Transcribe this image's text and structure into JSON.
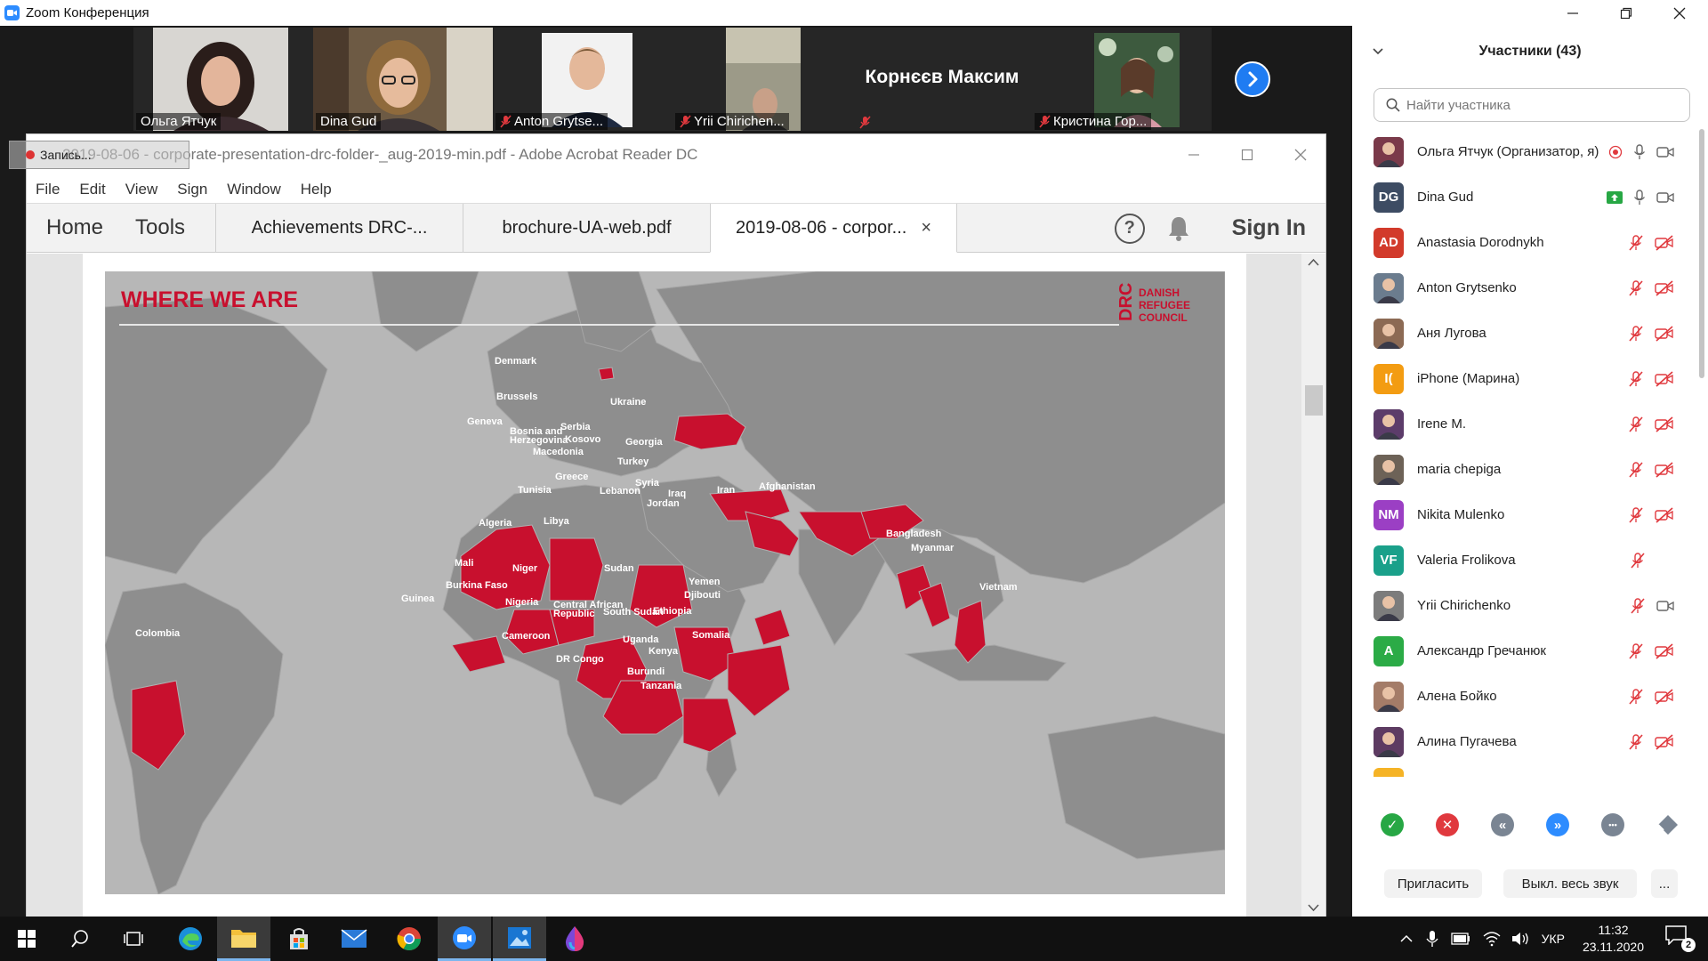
{
  "zoom": {
    "window_title": "Zoom Конференция"
  },
  "video_strip": {
    "tiles": [
      {
        "name": "Ольга Ятчук",
        "muted": false,
        "active": false
      },
      {
        "name": "Dina Gud",
        "muted": false,
        "active": true
      },
      {
        "name": "Anton Grytse...",
        "muted": true,
        "active": false
      },
      {
        "name": "Yrii Chirichen...",
        "muted": true,
        "active": false
      },
      {
        "name": "Корнєєв Максим",
        "muted": true,
        "active": false
      },
      {
        "name": "Кристина Гор...",
        "muted": true,
        "active": false
      }
    ]
  },
  "share_badge": {
    "label": "Запись..."
  },
  "acrobat": {
    "window_title": "2019-08-06 - corporate-presentation-drc-folder-_aug-2019-min.pdf - Adobe Acrobat Reader DC",
    "menu": [
      "File",
      "Edit",
      "View",
      "Sign",
      "Window",
      "Help"
    ],
    "nav": {
      "home": "Home",
      "tools": "Tools"
    },
    "tabs": [
      {
        "label": "Achievements DRC-...",
        "active": false
      },
      {
        "label": "brochure-UA-web.pdf",
        "active": false
      },
      {
        "label": "2019-08-06 - corpor...",
        "active": true
      }
    ],
    "tab_close": "×",
    "sign_in": "Sign In",
    "help_glyph": "?"
  },
  "slide": {
    "title": "WHERE WE ARE",
    "logo": {
      "mark": "DRC",
      "line1": "DANISH",
      "line2": "REFUGEE",
      "line3": "COUNCIL"
    },
    "country_labels": [
      "Denmark",
      "Brussels",
      "Ukraine",
      "Geneva",
      "Bosnia and Herzegovina",
      "Serbia",
      "Kosovo",
      "Georgia",
      "Macedonia",
      "Turkey",
      "Greece",
      "Syria",
      "Lebanon",
      "Iraq",
      "Iran",
      "Afghanistan",
      "Jordan",
      "Tunisia",
      "Algeria",
      "Libya",
      "Mali",
      "Niger",
      "Sudan",
      "Yemen",
      "Djibouti",
      "Burkina Faso",
      "Guinea",
      "Nigeria",
      "Central African Republic",
      "South Sudan",
      "Ethiopia",
      "Cameroon",
      "Somalia",
      "Uganda",
      "Kenya",
      "DR Congo",
      "Burundi",
      "Tanzania",
      "Colombia",
      "Bangladesh",
      "Myanmar",
      "Vietnam"
    ]
  },
  "participants": {
    "title": "Участники (43)",
    "search_placeholder": "Найти участника",
    "list": [
      {
        "name": "Ольга Ятчук (Организатор, я)",
        "avatar": "photo",
        "color": "#7a3a4a",
        "mic": "on",
        "video": "on",
        "extra": "record"
      },
      {
        "name": "Dina Gud",
        "initials": "DG",
        "color": "#3d4c63",
        "mic": "on",
        "video": "on",
        "extra": "share"
      },
      {
        "name": "Anastasia Dorodnykh",
        "initials": "AD",
        "color": "#d23a2b",
        "mic": "off",
        "video": "off"
      },
      {
        "name": "Anton Grytsenko",
        "avatar": "photo",
        "color": "#6b7c8e",
        "mic": "off",
        "video": "off"
      },
      {
        "name": "Аня Лугова",
        "avatar": "photo",
        "color": "#8c6a54",
        "mic": "off",
        "video": "off"
      },
      {
        "name": "iPhone (Марина)",
        "initials": "I(",
        "color": "#f39c12",
        "mic": "off",
        "video": "off"
      },
      {
        "name": "Irene M.",
        "avatar": "photo",
        "color": "#5c3c6a",
        "mic": "off",
        "video": "off"
      },
      {
        "name": "maria chepiga",
        "avatar": "photo",
        "color": "#6d6257",
        "mic": "off",
        "video": "off"
      },
      {
        "name": "Nikita Mulenko",
        "initials": "NM",
        "color": "#9b3fc4",
        "mic": "off",
        "video": "off"
      },
      {
        "name": "Valeria Frolikova",
        "initials": "VF",
        "color": "#1aa08a",
        "mic": "off",
        "video": "none"
      },
      {
        "name": "Yrii Chirichenko",
        "avatar": "photo",
        "color": "#7c7c7c",
        "mic": "off",
        "video": "on"
      },
      {
        "name": "Александр Гречанюк",
        "initials": "A",
        "color": "#2bab46",
        "mic": "off",
        "video": "off"
      },
      {
        "name": "Алена Бойко",
        "avatar": "photo",
        "color": "#a47c68",
        "mic": "off",
        "video": "off"
      },
      {
        "name": "Алина Пугачева",
        "avatar": "photo",
        "color": "#5d3b62",
        "mic": "off",
        "video": "off"
      }
    ],
    "reactions": [
      {
        "name": "yes",
        "glyph": "✓",
        "color": "#27a744"
      },
      {
        "name": "no",
        "glyph": "✕",
        "color": "#e0393e"
      },
      {
        "name": "slower",
        "glyph": "«",
        "color": "#7a8593"
      },
      {
        "name": "faster",
        "glyph": "»",
        "color": "#2d8cff"
      },
      {
        "name": "more",
        "glyph": "•••",
        "color": "#7a8593"
      },
      {
        "name": "clear",
        "glyph": "",
        "color": "#7a8593"
      }
    ],
    "invite_label": "Пригласить",
    "mute_all_label": "Выкл. весь звук",
    "more_label": "..."
  },
  "taskbar": {
    "language": "УКР",
    "time": "11:32",
    "date": "23.11.2020",
    "notification_count": "2"
  },
  "colors": {
    "drc_red": "#c8102e",
    "zoom_blue": "#2d8cff"
  }
}
